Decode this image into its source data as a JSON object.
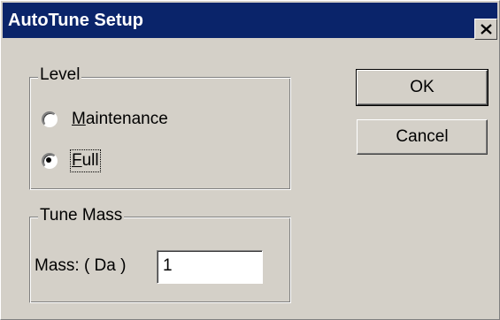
{
  "window": {
    "title": "AutoTune Setup"
  },
  "level_group": {
    "title": "Level",
    "options": [
      {
        "label_mnemonic": "M",
        "label_rest": "aintenance",
        "selected": false
      },
      {
        "label_mnemonic": "F",
        "label_rest": "ull",
        "selected": true
      }
    ]
  },
  "tune_mass_group": {
    "title": "Tune Mass",
    "mass_label": "Mass: ( Da )",
    "mass_value": "1"
  },
  "buttons": {
    "ok": "OK",
    "cancel": "Cancel"
  },
  "icons": {
    "close": "close-icon"
  },
  "colors": {
    "titlebar": "#0a246a",
    "face": "#d4d0c8"
  }
}
